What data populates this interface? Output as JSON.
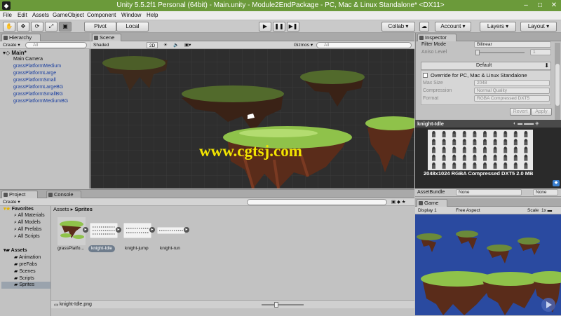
{
  "titlebar": {
    "title": "Unity 5.5.2f1 Personal (64bit) - Main.unity - Module2EndPackage - PC, Mac & Linux Standalone* <DX11>",
    "minimize": "–",
    "maximize": "□",
    "close": "✕"
  },
  "menu": [
    "File",
    "Edit",
    "Assets",
    "GameObject",
    "Component",
    "Window",
    "Help"
  ],
  "toolbar": {
    "pivot": "Pivot",
    "local": "Local",
    "collab": "Collab ▾",
    "account": "Account ▾",
    "layers": "Layers ▾",
    "layout": "Layout ▾"
  },
  "hierarchy": {
    "tab": "Hierarchy",
    "create": "Create ▾",
    "search_placeholder": "All",
    "scene": "Main*",
    "items": [
      "Main Camera",
      "grassPlatformMedium",
      "grassPlatformLarge",
      "grassPlatformSmall",
      "grassPlatformLargeBG",
      "grassPlatformSmallBG",
      "grassPlatformMediumBG"
    ]
  },
  "scene": {
    "tab": "Scene",
    "shading": "Shaded",
    "mode2d": "2D",
    "gizmos": "Gizmos ▾",
    "search_placeholder": "All",
    "watermark": "www.cgtsj.com"
  },
  "inspector": {
    "tab": "Inspector",
    "filter_mode_label": "Filter Mode",
    "filter_mode_value": "Bilinear",
    "aniso_label": "Aniso Level",
    "aniso_value": "1",
    "platform_tab": "Default",
    "override_label": "Override for PC, Mac & Linux Standalone",
    "max_size_label": "Max Size",
    "max_size_value": "2048",
    "compression_label": "Compression",
    "compression_value": "Normal Quality",
    "format_label": "Format",
    "format_value": "RGBA Compressed DXT5",
    "revert": "Revert",
    "apply": "Apply"
  },
  "preview": {
    "title": "knight-Idle",
    "info": "2048x1024  RGBA Compressed DXT5  2.0 MB",
    "assetbundle_label": "AssetBundle",
    "assetbundle_value": "None",
    "variant_value": "None"
  },
  "project": {
    "tab": "Project",
    "console_tab": "Console",
    "create": "Create ▾",
    "favorites_label": "Favorites",
    "favorites": [
      "All Materials",
      "All Models",
      "All Prefabs",
      "All Scripts"
    ],
    "assets_label": "Assets",
    "folders": [
      "Animation",
      "preFabs",
      "Scenes",
      "Scripts",
      "Sprites"
    ],
    "breadcrumb_root": "Assets",
    "breadcrumb_current": "Sprites",
    "assets": [
      "grassPlatfo...",
      "knight-Idle",
      "knight-jump",
      "knight-run"
    ],
    "selected_file": "knight-Idle.png"
  },
  "game": {
    "tab": "Game",
    "display": "Display 1",
    "aspect": "Free Aspect",
    "scale_label": "Scale"
  },
  "colors": {
    "titlebar": "#6b9a3a",
    "scene_bg": "#2c2c2c",
    "game_sky": "#2a4aa0",
    "grass": "#8fc24a",
    "rock": "#5a2c1a",
    "watermark": "#f2e400"
  }
}
